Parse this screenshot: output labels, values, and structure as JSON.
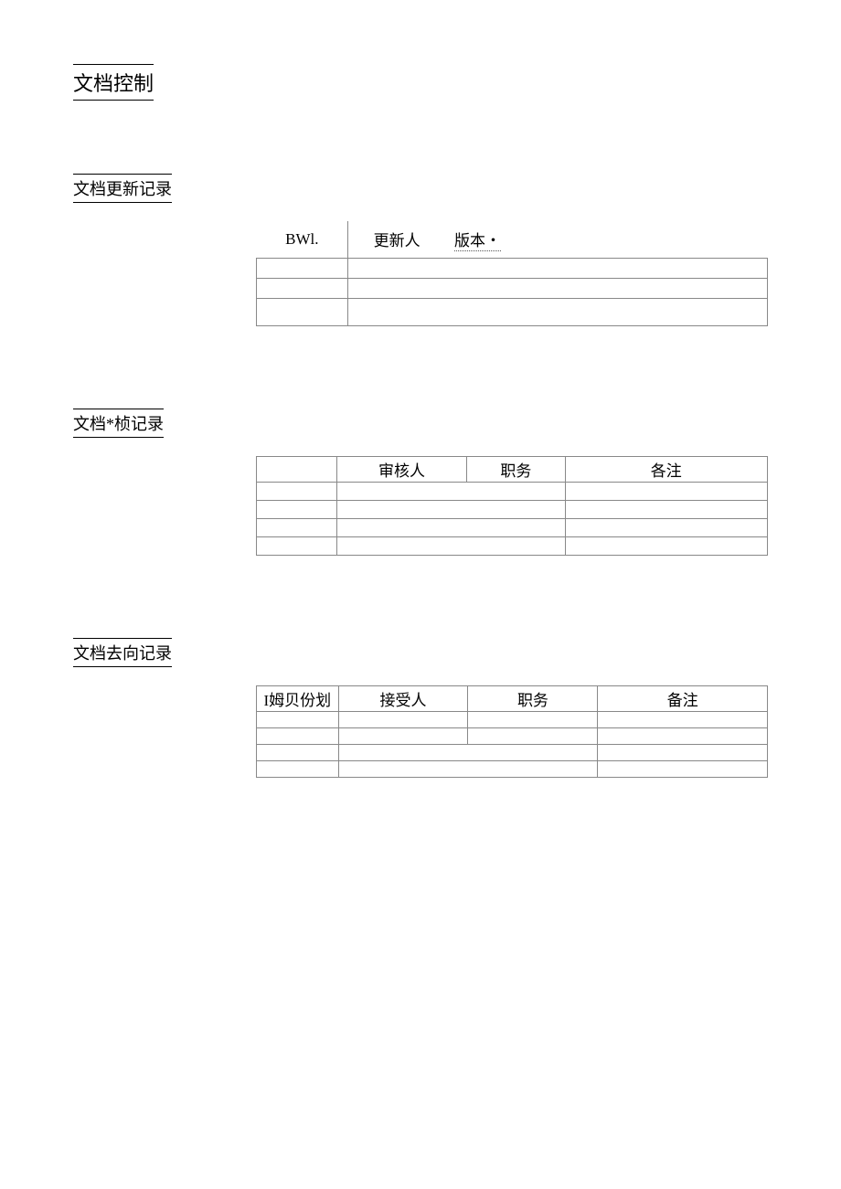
{
  "title": "文档控制",
  "section1": {
    "heading": "文档更新记录",
    "h1": "BWl.",
    "h2": "更新人",
    "h3": "版本・"
  },
  "section2": {
    "heading": "文档*桢记录",
    "h1": "审核人",
    "h2": "职务",
    "h3": "各注"
  },
  "section3": {
    "heading": "文档去向记录",
    "h1": "I姆贝份划",
    "h2": "接受人",
    "h3": "职务",
    "h4": "备注"
  }
}
